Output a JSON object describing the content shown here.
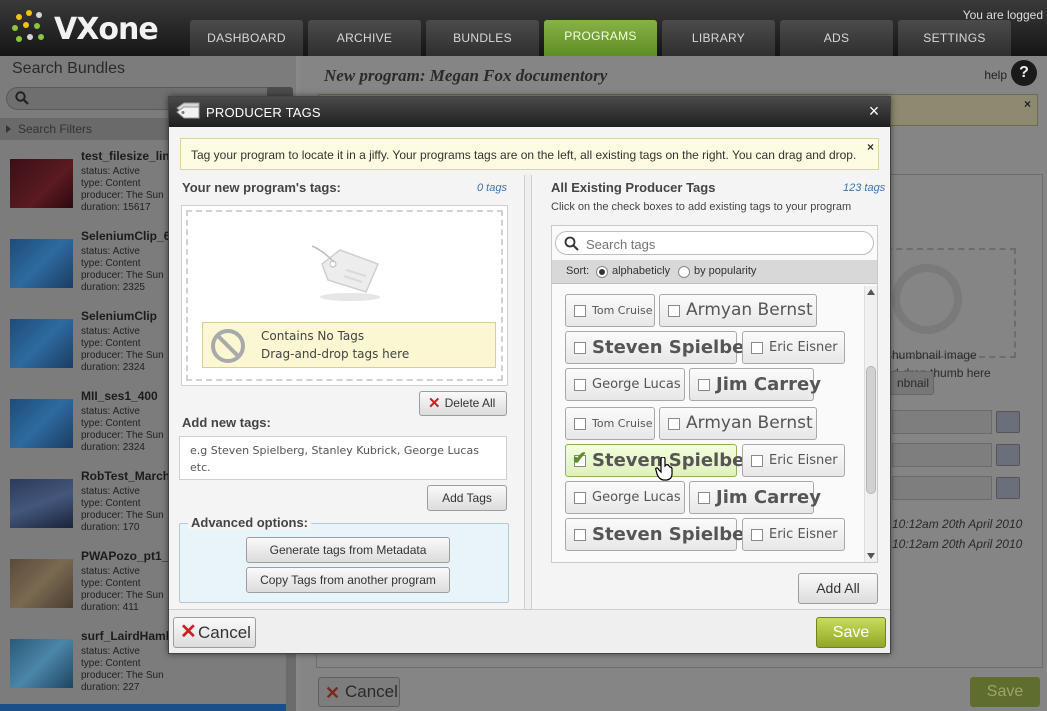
{
  "app": {
    "logo_text": "VXone",
    "logged_text": "You are logged"
  },
  "nav": {
    "tabs": [
      {
        "label": "DASHBOARD"
      },
      {
        "label": "ARCHIVE"
      },
      {
        "label": "BUNDLES"
      },
      {
        "label": "PROGRAMS"
      },
      {
        "label": "LIBRARY"
      },
      {
        "label": "ADS"
      },
      {
        "label": "SETTINGS"
      }
    ],
    "active": "PROGRAMS"
  },
  "sidebar": {
    "title": "Search Bundles",
    "filters_label": "Search Filters",
    "items": [
      {
        "name": "test_filesize_lin",
        "status": "status: Active",
        "type": "type: Content",
        "producer": "producer: The Sun",
        "duration": "duration: 15617"
      },
      {
        "name": "SeleniumClip_6",
        "status": "status: Active",
        "type": "type: Content",
        "producer": "producer: The Sun",
        "duration": "duration: 2325"
      },
      {
        "name": "SeleniumClip",
        "status": "status: Active",
        "type": "type: Content",
        "producer": "producer: The Sun",
        "duration": "duration: 2324"
      },
      {
        "name": "MII_ses1_400",
        "status": "status: Active",
        "type": "type: Content",
        "producer": "producer: The Sun",
        "duration": "duration: 2324"
      },
      {
        "name": "RobTest_March",
        "status": "status: Active",
        "type": "type: Content",
        "producer": "producer: The Sun",
        "duration": "duration: 170"
      },
      {
        "name": "PWAPozo_pt1_",
        "status": "status: Active",
        "type": "type: Content",
        "producer": "producer: The Sun",
        "duration": "duration: 411"
      },
      {
        "name": "surf_LairdHaml",
        "status": "status: Active",
        "type": "type: Content",
        "producer": "producer: The Sun",
        "duration": "duration: 227"
      }
    ]
  },
  "main": {
    "title": "New program: Megan Fox documentory",
    "help_label": "help",
    "help_glyph": "?",
    "thumb_text_1": "humbnail image",
    "thumb_text_2": "d-drop thumb here",
    "thumb_button": "nbnail",
    "date_1": "10:12am  20th April 2010",
    "date_2": "10:12am  20th April 2010",
    "cancel_label": "Cancel",
    "save_label": "Save"
  },
  "modal": {
    "title": "PRODUCER TAGS",
    "close_glyph": "×",
    "info": "Tag your program to locate it in a jiffy. Your programs tags are on the left, all existing tags on the right. You can drag and drop.",
    "info_close": "×",
    "left": {
      "title": "Your new program's tags:",
      "count": "0 tags",
      "empty_line1": "Contains No Tags",
      "empty_line2": "Drag-and-drop tags here",
      "delete_all": "Delete All",
      "add_title": "Add new tags:",
      "add_placeholder": "e.g Steven Spielberg, Stanley Kubrick, George Lucas etc.",
      "add_button": "Add Tags",
      "advanced_title": "Advanced options:",
      "generate_button": "Generate tags from Metadata",
      "copy_button": "Copy Tags from another program"
    },
    "right": {
      "title": "All Existing Producer Tags",
      "count": "123 tags",
      "subtitle": "Click on the check boxes to add existing tags to your program",
      "search_placeholder": "Search tags",
      "sort_label": "Sort:",
      "sort_options": [
        {
          "label": "alphabeticly",
          "selected": true
        },
        {
          "label": "by popularity",
          "selected": false
        }
      ],
      "tags": [
        {
          "label": "Tom Cruise",
          "checked": false
        },
        {
          "label": "Armyan Bernst",
          "checked": false
        },
        {
          "label": "Steven Spielberg",
          "checked": false
        },
        {
          "label": "Eric Eisner",
          "checked": false
        },
        {
          "label": "George Lucas",
          "checked": false
        },
        {
          "label": "Jim Carrey",
          "checked": false
        },
        {
          "label": "Tom Cruise",
          "checked": false
        },
        {
          "label": "Armyan Bernst",
          "checked": false
        },
        {
          "label": "Steven Spielberg",
          "checked": true
        },
        {
          "label": "Eric Eisner",
          "checked": false
        },
        {
          "label": "George Lucas",
          "checked": false
        },
        {
          "label": "Jim Carrey",
          "checked": false
        },
        {
          "label": "Steven Spielberg",
          "checked": false
        },
        {
          "label": "Eric Eisner",
          "checked": false
        }
      ],
      "add_all": "Add All"
    },
    "footer": {
      "cancel": "Cancel",
      "save": "Save"
    }
  },
  "colors": {
    "accent_green": "#86b245",
    "save_green": "#a7bf3a",
    "link_blue": "#3b73a8",
    "delete_red": "#c72222"
  }
}
